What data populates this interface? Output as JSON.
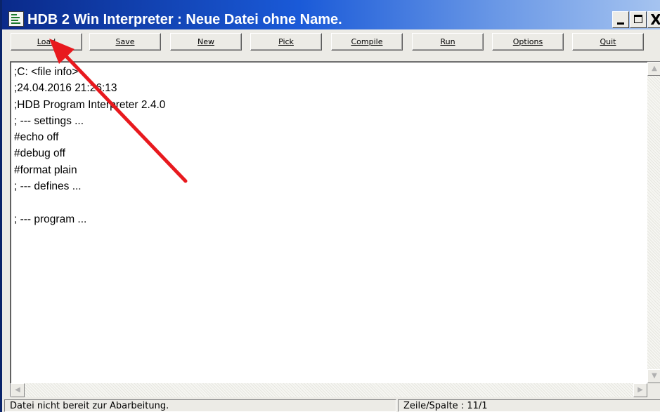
{
  "window": {
    "title": "HDB 2 Win Interpreter : Neue Datei ohne Name.",
    "controls": {
      "minimize": "_",
      "maximize": "□",
      "close": "X"
    }
  },
  "toolbar": {
    "buttons": [
      {
        "label": "Load"
      },
      {
        "label": "Save"
      },
      {
        "label": "New"
      },
      {
        "label": "Pick"
      },
      {
        "label": "Compile"
      },
      {
        "label": "Run"
      },
      {
        "label": "Options"
      },
      {
        "label": "Quit"
      }
    ]
  },
  "editor": {
    "lines": [
      ";C: <file info>",
      ";24.04.2016 21:26:13",
      ";HDB Program Interpreter 2.4.0",
      "; --- settings ...",
      "#echo off",
      "#debug off",
      "#format plain",
      "; --- defines ...",
      "",
      "; --- program ..."
    ]
  },
  "scrollbars": {
    "up_arrow": "▲",
    "down_arrow": "▼",
    "left_arrow": "◀",
    "right_arrow": "▶"
  },
  "statusbar": {
    "message": "Datei nicht bereit zur Abarbeitung.",
    "position": "Zeile/Spalte : 11/1"
  },
  "colors": {
    "annotation_arrow": "#e8191e",
    "titlebar_start": "#0a2a8a",
    "titlebar_end": "#a6c4f0"
  },
  "icons": {
    "app": "program-editor-icon"
  }
}
